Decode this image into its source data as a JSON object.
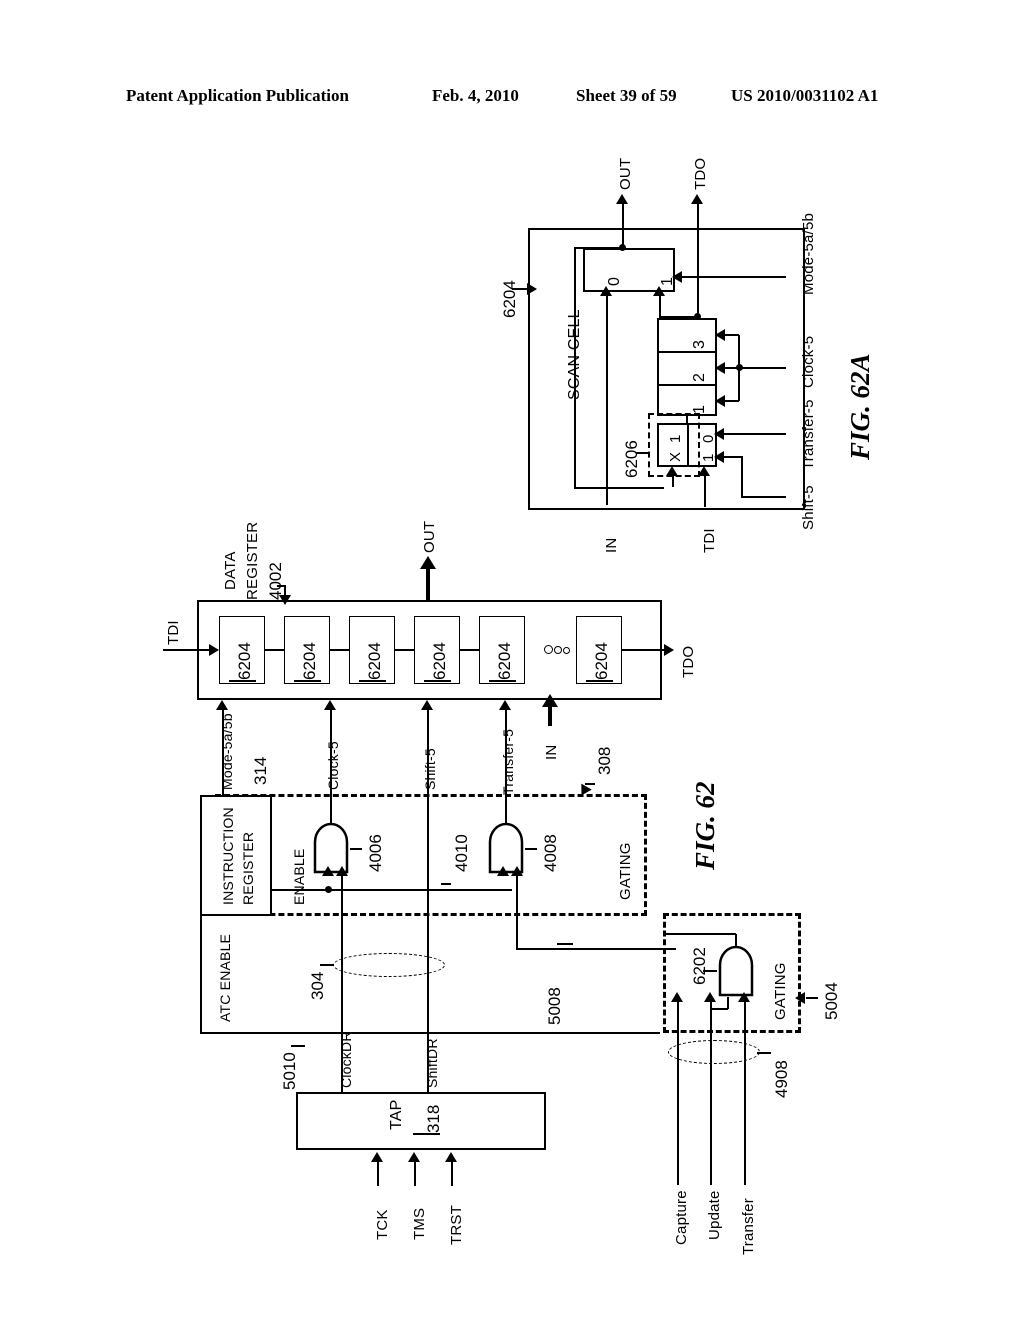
{
  "header": {
    "publication": "Patent Application Publication",
    "date": "Feb. 4, 2010",
    "sheet": "Sheet 39 of 59",
    "number": "US 2010/0031102 A1"
  },
  "fig62a": {
    "title": "FIG. 62A",
    "block_label": "SCAN CELL",
    "ref_scan_cell": "6204",
    "ref_mux_dashed": "6206",
    "outputs": {
      "out": "OUT",
      "tdo": "TDO"
    },
    "inputs": {
      "in": "IN",
      "tdi": "TDI"
    },
    "control_signals": [
      "Shift-5",
      "Transfer-5",
      "Clock-5",
      "Mode-5a/5b"
    ],
    "output_mux_labels": [
      "0",
      "1"
    ],
    "shift_register_stages": [
      "1",
      "2",
      "3"
    ],
    "input_mux_top_labels": [
      "X",
      "1"
    ],
    "input_mux_bottom_labels": [
      "1",
      "0"
    ]
  },
  "fig62": {
    "title": "FIG. 62",
    "data_register": {
      "label_line1": "DATA",
      "label_line2": "REGISTER",
      "ref": "4002",
      "cells": [
        "6204",
        "6204",
        "6204",
        "6204",
        "6204",
        "6204"
      ],
      "ellipsis": "o o o",
      "tdi": "TDI",
      "tdo": "TDO",
      "out": "OUT",
      "in": "IN"
    },
    "control_signals": [
      {
        "name": "Mode-5a/5b"
      },
      {
        "name": "Clock-5"
      },
      {
        "name": "Shift-5"
      },
      {
        "name": "Transfer-5"
      }
    ],
    "instruction_register": {
      "line1": "INSTRUCTION",
      "line2": "REGISTER",
      "ref": "314",
      "enable_label": "ENABLE"
    },
    "gating_top": {
      "label": "GATING",
      "ref": "308",
      "gate_clock_ref": "4006",
      "gate_transfer_ref": "4008",
      "wire_ref": "4010"
    },
    "gating_bottom": {
      "label": "GATING",
      "ref": "5004",
      "gate_ref": "6202",
      "bus_ref": "4908",
      "inputs": [
        "Capture",
        "Update",
        "Transfer"
      ]
    },
    "atc_enable": {
      "label": "ATC ENABLE",
      "ref": "5010"
    },
    "bus_ref_304": "304",
    "wire_ref_5008": "5008",
    "tap": {
      "label": "TAP",
      "ref": "318",
      "inputs": [
        "TCK",
        "TMS",
        "TRST"
      ],
      "outputs": [
        "ClockDR",
        "ShiftDR"
      ]
    }
  }
}
